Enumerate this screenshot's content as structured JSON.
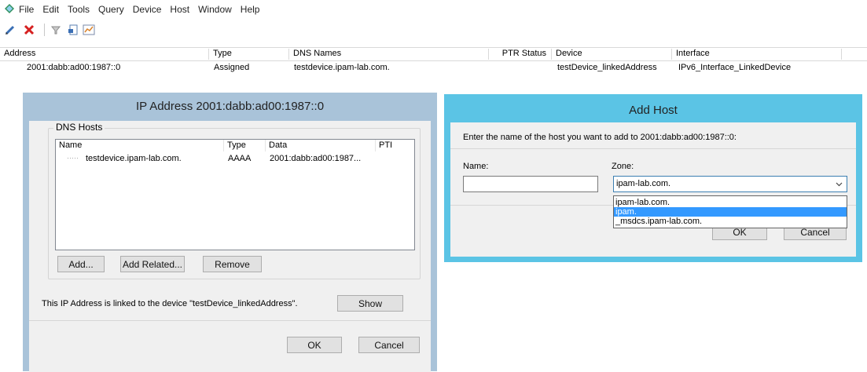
{
  "menu": {
    "items": [
      "File",
      "Edit",
      "Tools",
      "Query",
      "Device",
      "Host",
      "Window",
      "Help"
    ]
  },
  "toolbar": {
    "icons": [
      "pencil-icon",
      "delete-x-icon",
      "filter-icon",
      "report-icon",
      "chart-icon"
    ]
  },
  "grid": {
    "columns": [
      "Address",
      "Type",
      "DNS Names",
      "PTR Status",
      "Device",
      "Interface"
    ],
    "rows": [
      {
        "address": "2001:dabb:ad00:1987::0",
        "type": "Assigned",
        "dns_names": "testdevice.ipam-lab.com.",
        "ptr_status": "",
        "device": "testDevice_linkedAddress",
        "interface": "IPv6_Interface_LinkedDevice"
      }
    ]
  },
  "ip_dialog": {
    "title": "IP Address 2001:dabb:ad00:1987::0",
    "group_label": "DNS Hosts",
    "list_columns": [
      "Name",
      "Type",
      "Data",
      "PTI"
    ],
    "list_rows": [
      {
        "prefix": "·····",
        "name": "testdevice.ipam-lab.com.",
        "type": "AAAA",
        "data": "2001:dabb:ad00:1987..."
      }
    ],
    "add_label": "Add...",
    "add_related_label": "Add Related...",
    "remove_label": "Remove",
    "linked_text": "This IP Address is linked to the device \"testDevice_linkedAddress\".",
    "show_label": "Show",
    "ok_label": "OK",
    "cancel_label": "Cancel"
  },
  "host_dialog": {
    "title": "Add Host",
    "prompt": "Enter the name of the host you want to add to 2001:dabb:ad00:1987::0:",
    "name_label": "Name:",
    "name_value": "",
    "zone_label": "Zone:",
    "zone_selected": "ipam-lab.com.",
    "zone_options": [
      "ipam-lab.com.",
      "ipam.",
      "_msdcs.ipam-lab.com."
    ],
    "zone_highlighted": "ipam.",
    "ok_label": "OK",
    "cancel_label": "Cancel"
  },
  "colors": {
    "ip_dialog_frame": "#a9c3d9",
    "host_dialog_frame": "#5bc4e5",
    "selection": "#3399ff"
  }
}
